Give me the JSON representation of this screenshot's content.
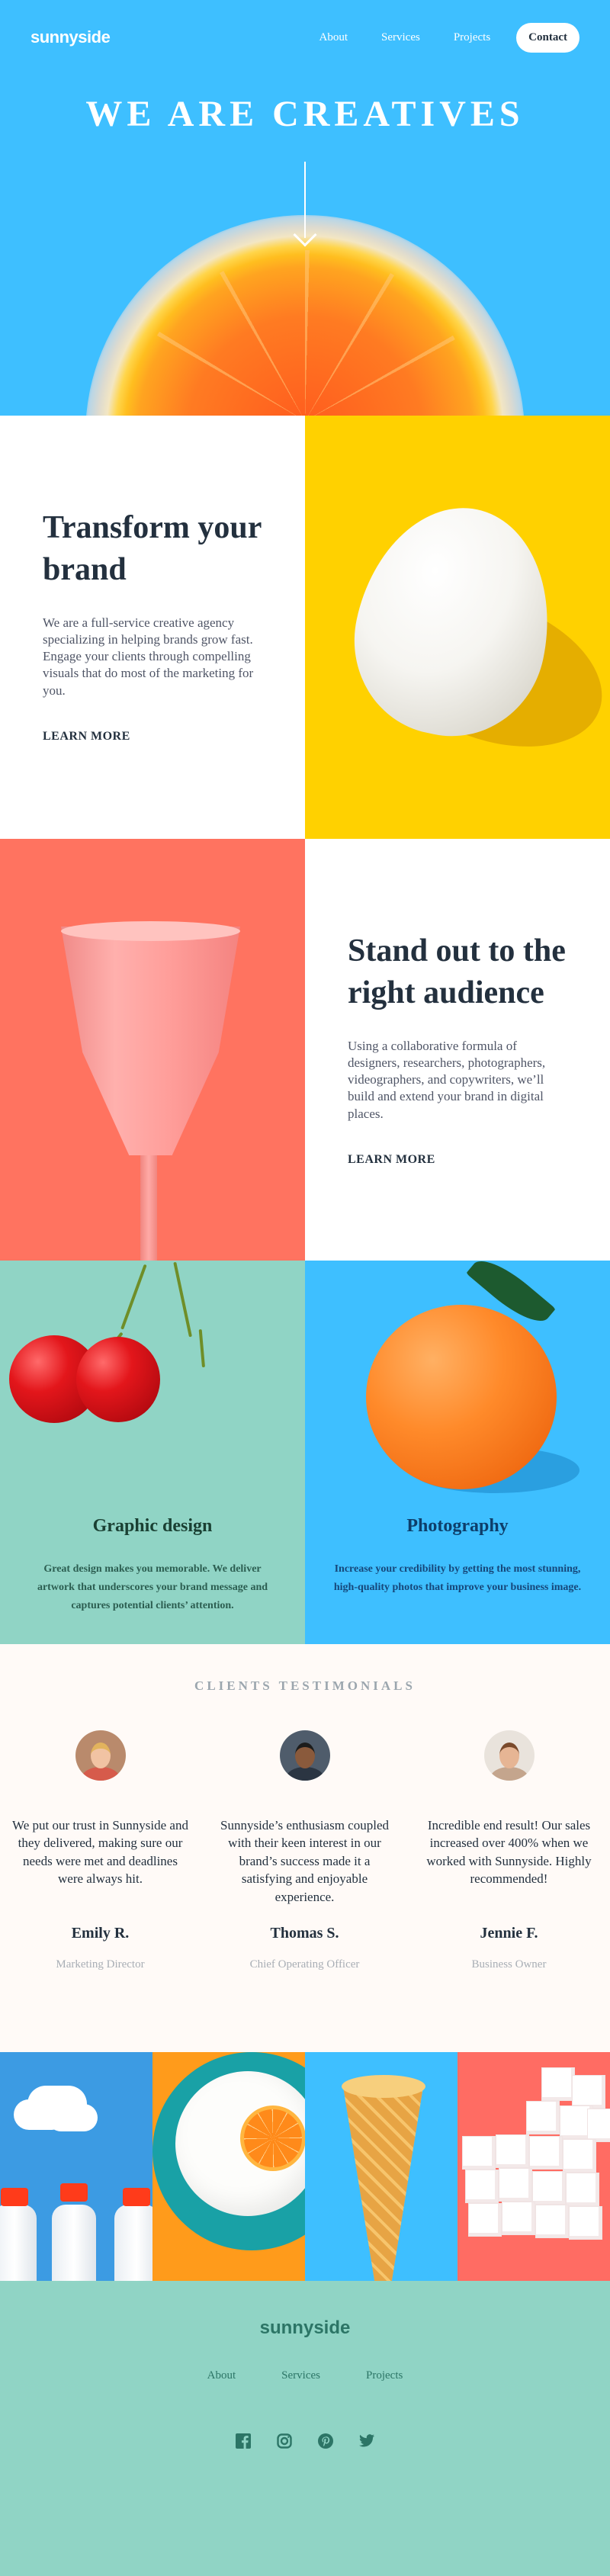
{
  "nav": {
    "logo": "sunnyside",
    "links": [
      "About",
      "Services",
      "Projects"
    ],
    "contact": "Contact"
  },
  "hero": {
    "title": "WE ARE CREATIVES"
  },
  "features": [
    {
      "title": "Transform your brand",
      "body": "We are a full-service creative agency specializing in helping brands grow fast. Engage your clients through compelling visuals that do most of the marketing for you.",
      "link": "LEARN MORE"
    },
    {
      "title": "Stand out to the right audience",
      "body": "Using a collaborative formula of designers, researchers, photographers, videographers, and copywriters, we’ll build and extend your brand in digital places.",
      "link": "LEARN MORE"
    }
  ],
  "services": [
    {
      "title": "Graphic design",
      "body": "Great design makes you memorable. We deliver artwork that underscores your brand message and captures potential clients’ attention."
    },
    {
      "title": "Photography",
      "body": "Increase your credibility by getting the most stunning, high-quality photos that improve your business image."
    }
  ],
  "testimonials": {
    "heading": "CLIENTS TESTIMONIALS",
    "items": [
      {
        "quote": "We put our trust in Sunnyside and they delivered, making sure our needs were met and deadlines were always hit.",
        "name": "Emily R.",
        "role": "Marketing Director"
      },
      {
        "quote": "Sunnyside’s enthusiasm coupled with their keen interest in our brand’s success made it a satisfying and enjoyable experience.",
        "name": "Thomas S.",
        "role": "Chief Operating Officer"
      },
      {
        "quote": "Incredible end result! Our sales increased over 400% when we worked with Sunnyside. Highly recommended!",
        "name": "Jennie F.",
        "role": "Business Owner"
      }
    ]
  },
  "footer": {
    "logo": "sunnyside",
    "links": [
      "About",
      "Services",
      "Projects"
    ],
    "social": [
      "facebook-icon",
      "instagram-icon",
      "pinterest-icon",
      "twitter-icon"
    ]
  },
  "colors": {
    "hero_blue": "#3ebfff",
    "yellow": "#ffd100",
    "coral": "#ff7360",
    "mint": "#90d4c5",
    "dark_text": "#23303e",
    "footer_text": "#2c7566"
  }
}
